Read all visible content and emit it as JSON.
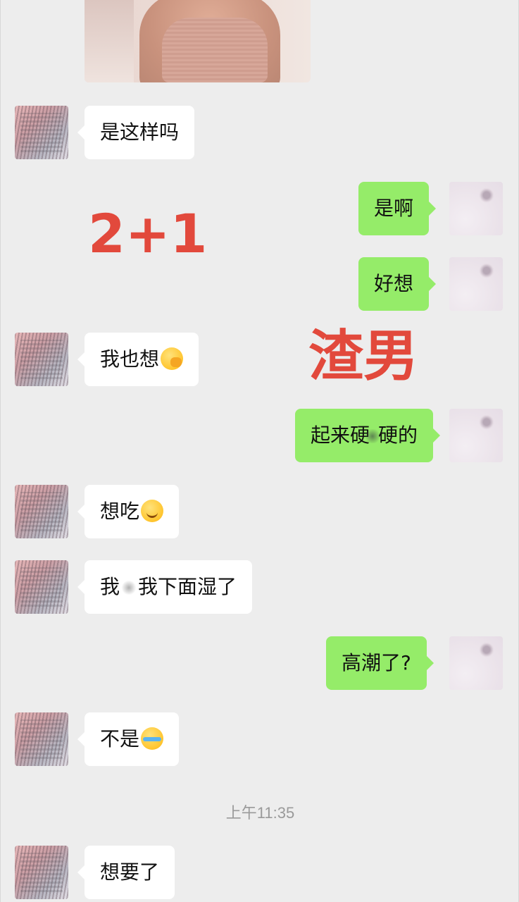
{
  "chat": {
    "colors": {
      "background": "#ededed",
      "incoming_bubble": "#ffffff",
      "outgoing_bubble": "#95ec69",
      "overlay_text": "#e2493c",
      "timestamp": "#9a9a9a"
    },
    "messages": [
      {
        "side": "in",
        "text": "是这样吗"
      },
      {
        "side": "out",
        "text": "是啊"
      },
      {
        "side": "out",
        "text": "好想"
      },
      {
        "side": "in",
        "text": "我也想",
        "emoji": "hand-over-mouth-emoji"
      },
      {
        "side": "out",
        "text_before": "起来硬",
        "text_after": "硬的"
      },
      {
        "side": "in",
        "text": "想吃",
        "emoji": "smiling-emoji"
      },
      {
        "side": "in",
        "text_before": "我",
        "text_after": "我下面湿了"
      },
      {
        "side": "out",
        "text": "高潮了?"
      },
      {
        "side": "in",
        "text": "不是",
        "emoji": "crying-laughing-emoji"
      },
      {
        "side": "in",
        "text": "想要了"
      }
    ],
    "timestamp": "上午11:35"
  },
  "overlay": {
    "label_1": "2+1",
    "label_2": "渣男"
  }
}
